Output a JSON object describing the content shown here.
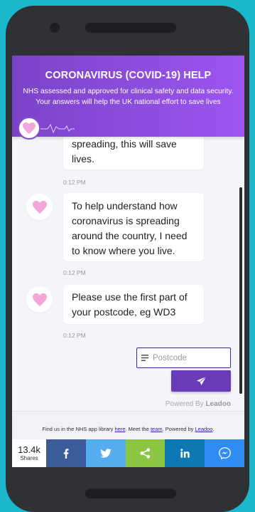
{
  "header": {
    "title": "CORONAVIRUS (COVID-19) HELP",
    "subtitle": "NHS assessed and approved for clinical safety and data security. Your answers will help the UK national effort to save lives"
  },
  "messages": [
    {
      "text": "spreading, this will save lives.",
      "time": "0:12 PM"
    },
    {
      "text": "To help understand how coronavirus is spreading around the country, I need to know where you live.",
      "time": "0:12 PM"
    },
    {
      "text": "Please use the first part of your postcode, eg WD3",
      "time": "0:12 PM"
    }
  ],
  "input": {
    "placeholder": "Postcode",
    "value": ""
  },
  "powered_by": {
    "prefix": "Powered By",
    "brand": "Leadoo"
  },
  "footer": {
    "part1": "Find us in the NHS app library ",
    "link1": "here",
    "part2": ". Meet the ",
    "link2": "team",
    "part3": ". Powered by ",
    "link3": "Leadoo",
    "part4": "."
  },
  "share": {
    "count": "13.4k",
    "count_label": "Shares"
  },
  "colors": {
    "header_start": "#7b43c8",
    "header_end": "#9c55f0",
    "send_button": "#6a3bb8",
    "facebook": "#3b5b9b",
    "twitter": "#55acee",
    "share": "#8cc542",
    "linkedin": "#0e78b5",
    "messenger": "#2f8cf2"
  },
  "icons": [
    "heart-icon",
    "pulse-line-icon",
    "list-icon",
    "send-icon",
    "facebook-icon",
    "twitter-icon",
    "share-icon",
    "linkedin-icon",
    "messenger-icon"
  ]
}
